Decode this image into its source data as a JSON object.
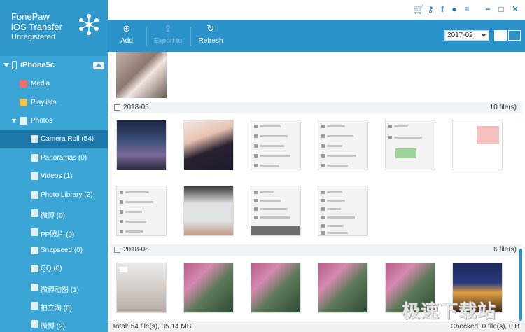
{
  "app": {
    "title": "FonePaw iOS Transfer",
    "subtitle": "Unregistered"
  },
  "device": {
    "name": "iPhone5c"
  },
  "sidebar": {
    "items": [
      {
        "label": "Media",
        "icon": "music-icon",
        "level": 1
      },
      {
        "label": "Playlists",
        "icon": "playlist-icon",
        "level": 1
      },
      {
        "label": "Photos",
        "icon": "photos-icon",
        "level": 1,
        "expanded": true
      },
      {
        "label": "Camera Roll (54)",
        "icon": "camera-icon",
        "level": 2,
        "active": true
      },
      {
        "label": "Panoramas (0)",
        "icon": "album-icon",
        "level": 2
      },
      {
        "label": "Videos (1)",
        "icon": "album-icon",
        "level": 2
      },
      {
        "label": "Photo Library (2)",
        "icon": "album-icon",
        "level": 2
      },
      {
        "label": "微博 (0)",
        "icon": "album-icon",
        "level": 2
      },
      {
        "label": "PP照片 (0)",
        "icon": "album-icon",
        "level": 2
      },
      {
        "label": "Snapseed (0)",
        "icon": "album-icon",
        "level": 2
      },
      {
        "label": "QQ (0)",
        "icon": "album-icon",
        "level": 2
      },
      {
        "label": "微博动图 (1)",
        "icon": "album-icon",
        "level": 2
      },
      {
        "label": "拍立淘 (0)",
        "icon": "album-icon",
        "level": 2
      },
      {
        "label": "微博 (2)",
        "icon": "album-icon",
        "level": 2
      }
    ]
  },
  "titlebar_icons": [
    "cart-icon",
    "key-icon",
    "facebook-icon",
    "chat-icon",
    "menu-icon",
    "minimize-icon",
    "maximize-icon",
    "close-icon"
  ],
  "toolbar": {
    "add_label": "Add",
    "export_label": "Export to",
    "refresh_label": "Refresh",
    "date_select": "2017-02"
  },
  "groups": [
    {
      "date": "2018-05",
      "count": "10 file(s)"
    },
    {
      "date": "2018-06",
      "count": "6 file(s)"
    }
  ],
  "status": {
    "total": "Total: 54 file(s), 35.14 MB",
    "checked": "Checked: 0 file(s), 0 B"
  },
  "watermark": "极速下载站",
  "colors": {
    "sidebar": "#3ba6d6",
    "toolbar": "#2b93c9",
    "active_item": "#1b78a9"
  }
}
